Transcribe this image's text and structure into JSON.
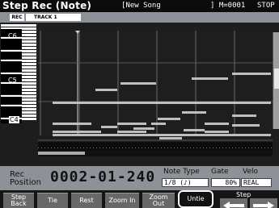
{
  "header": {
    "title": "Step Rec (Note)",
    "song": "[New Song",
    "measure": "] M=0001",
    "status": "STOP"
  },
  "track": {
    "rec_label": "REC",
    "track_label": "TRACK 1"
  },
  "keyboard": {
    "labels": [
      "C6",
      "C5",
      "C4"
    ]
  },
  "info": {
    "rec_position_label": "Rec Position",
    "position": "0002-01-240",
    "note_type_header": "Note Type",
    "gate_header": "Gate",
    "velo_header": "Velo",
    "note_type_value": "1/8  (♪)",
    "gate_value": "80%",
    "velo_value": "REAL"
  },
  "function_bar": {
    "step_back": "Step Back",
    "tie": "Tie",
    "rest": "Rest",
    "zoom_in": "Zoom In",
    "zoom_out": "Zoom Out",
    "untie": "Untie",
    "step": "Step"
  },
  "colors": {
    "title_bg": "#0b0b0b",
    "panel_gray": "#8e9298",
    "roll_bg": "#1d1d1d",
    "note": "#bfbfbf"
  }
}
